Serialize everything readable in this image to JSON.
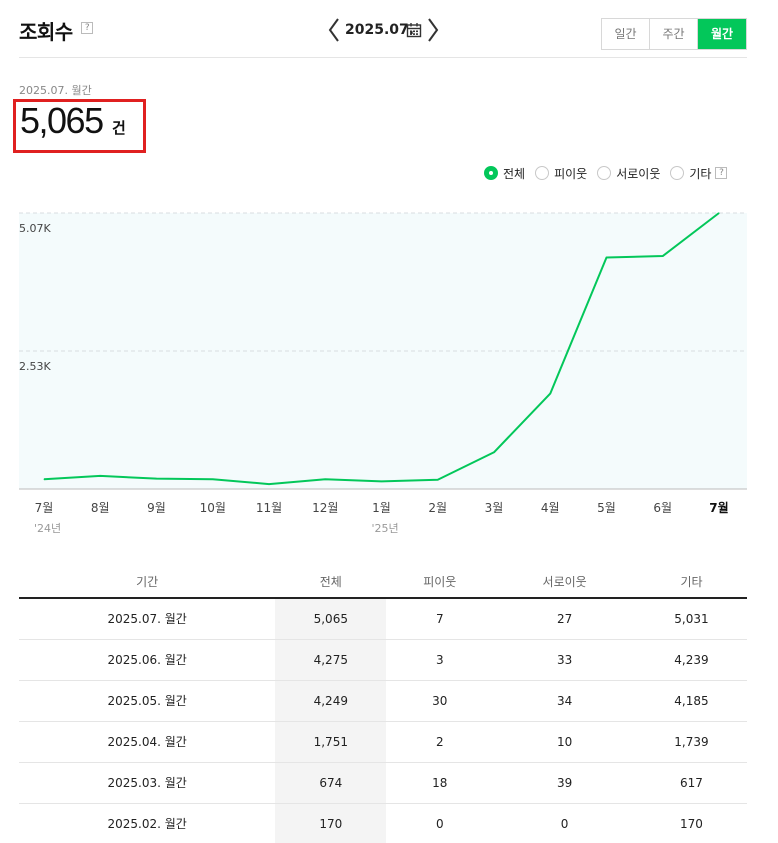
{
  "header": {
    "title": "조회수",
    "help_glyph": "?",
    "date": "2025.07.",
    "tabs": [
      {
        "label": "일간",
        "active": false
      },
      {
        "label": "주간",
        "active": false
      },
      {
        "label": "월간",
        "active": true
      }
    ]
  },
  "summary": {
    "period_label": "2025.07. 월간",
    "value": "5,065",
    "unit": "건"
  },
  "legend": {
    "items": [
      {
        "label": "전체",
        "selected": true
      },
      {
        "label": "피이웃",
        "selected": false
      },
      {
        "label": "서로이웃",
        "selected": false
      },
      {
        "label": "기타",
        "selected": false
      }
    ],
    "help_glyph": "?"
  },
  "colors": {
    "accent": "#03c75a",
    "highlight": "#e02020",
    "plot_bg": "#f4fbfc"
  },
  "chart_data": {
    "type": "line",
    "categories": [
      "7월",
      "8월",
      "9월",
      "10월",
      "11월",
      "12월",
      "1월",
      "2월",
      "3월",
      "4월",
      "5월",
      "6월",
      "7월"
    ],
    "year_labels": [
      {
        "index": 0,
        "label": "'24년"
      },
      {
        "index": 6,
        "label": "'25년"
      }
    ],
    "series": [
      {
        "name": "전체",
        "values": [
          180,
          240,
          190,
          180,
          90,
          180,
          140,
          170,
          674,
          1751,
          4249,
          4275,
          5065
        ]
      }
    ],
    "y_ticks": [
      {
        "value": 2532,
        "label": "2.53K"
      },
      {
        "value": 5065,
        "label": "5.07K"
      }
    ],
    "ylim": [
      0,
      5065
    ],
    "grid": true,
    "legend": "top-right"
  },
  "table": {
    "headers": [
      "기간",
      "전체",
      "피이웃",
      "서로이웃",
      "기타"
    ],
    "rows": [
      [
        "2025.07. 월간",
        "5,065",
        "7",
        "27",
        "5,031"
      ],
      [
        "2025.06. 월간",
        "4,275",
        "3",
        "33",
        "4,239"
      ],
      [
        "2025.05. 월간",
        "4,249",
        "30",
        "34",
        "4,185"
      ],
      [
        "2025.04. 월간",
        "1,751",
        "2",
        "10",
        "1,739"
      ],
      [
        "2025.03. 월간",
        "674",
        "18",
        "39",
        "617"
      ],
      [
        "2025.02. 월간",
        "170",
        "0",
        "0",
        "170"
      ]
    ]
  }
}
